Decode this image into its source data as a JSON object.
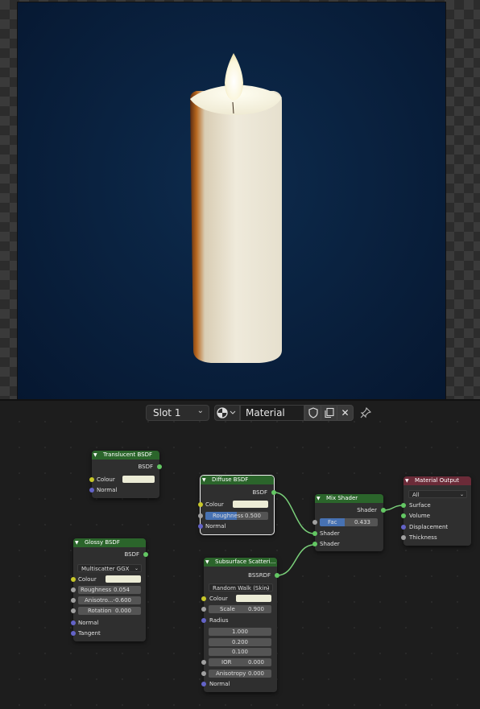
{
  "header": {
    "slot_label": "Slot 1",
    "material_name": "Material"
  },
  "nodes": {
    "translucent": {
      "title": "Translucent BSDF",
      "out": "BSDF",
      "colour": "Colour",
      "normal": "Normal"
    },
    "glossy": {
      "title": "Glossy BSDF",
      "out": "BSDF",
      "dist": "Multiscatter GGX",
      "colour": "Colour",
      "roughness_label": "Roughness",
      "roughness": "0.054",
      "aniso_label": "Anisotro...",
      "aniso": "-0.600",
      "rotation_label": "Rotation",
      "rotation": "0.000",
      "normal": "Normal",
      "tangent": "Tangent"
    },
    "diffuse": {
      "title": "Diffuse BSDF",
      "out": "BSDF",
      "colour": "Colour",
      "roughness_label": "Roughness",
      "roughness": "0.500",
      "normal": "Normal"
    },
    "mix": {
      "title": "Mix Shader",
      "out": "Shader",
      "fac_label": "Fac",
      "fac": "0.433",
      "in1": "Shader",
      "in2": "Shader"
    },
    "output": {
      "title": "Material Output",
      "target": "All",
      "surface": "Surface",
      "volume": "Volume",
      "displacement": "Displacement",
      "thickness": "Thickness"
    },
    "sss": {
      "title": "Subsurface Scatteri...",
      "out": "BSSRDF",
      "method": "Random Walk (Skin)",
      "colour": "Colour",
      "scale_label": "Scale",
      "scale": "0.900",
      "radius": "Radius",
      "r1": "1.000",
      "r2": "0.200",
      "r3": "0.100",
      "ior_label": "IOR",
      "ior": "0.000",
      "aniso_label": "Anisotropy",
      "aniso": "0.000",
      "normal": "Normal"
    }
  },
  "colors": {
    "node_header_green": "#2b652b",
    "node_header_red": "#6b2b38",
    "socket_shader": "#63c763",
    "socket_color": "#c7c729",
    "socket_vector": "#6363c7"
  }
}
